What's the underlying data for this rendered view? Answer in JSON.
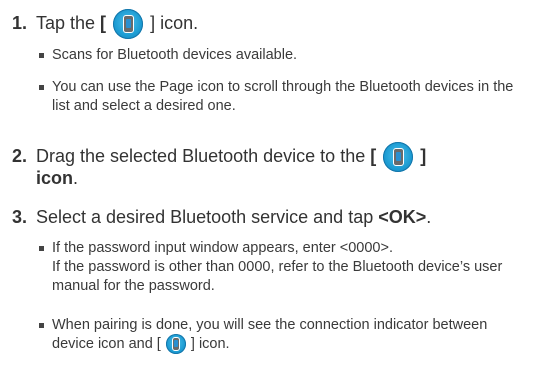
{
  "steps": [
    {
      "num": "1.",
      "pre": "Tap the ",
      "bracket_open": "[",
      "bracket_close": "]",
      "post": " icon."
    },
    {
      "num": "2.",
      "pre": "Drag the selected Bluetooth device to the ",
      "bracket_open": "[",
      "bracket_close": "]",
      "post_bold": "icon",
      "post": "."
    },
    {
      "num": "3.",
      "pre": "Select a desired Bluetooth service and tap ",
      "bold": "<OK>",
      "post": "."
    }
  ],
  "bullets": [
    {
      "text": "Scans for Bluetooth devices available."
    },
    {
      "text": "You can use the Page icon to scroll through the Bluetooth devices in the list and select a desired one."
    },
    {
      "line1": "If the password input window appears, enter <0000>.",
      "line2": "If the password is other than 0000, refer to the Bluetooth device’s user manual for the password."
    },
    {
      "pre": "When pairing is done, you will see the connection indicator between device icon and ",
      "bracket_open": "[",
      "bracket_close": "]",
      "post": " icon."
    }
  ],
  "icon_name": "bluetooth-phone-icon",
  "colors": {
    "icon_blue": "#1b9bd2",
    "text": "#333333"
  }
}
